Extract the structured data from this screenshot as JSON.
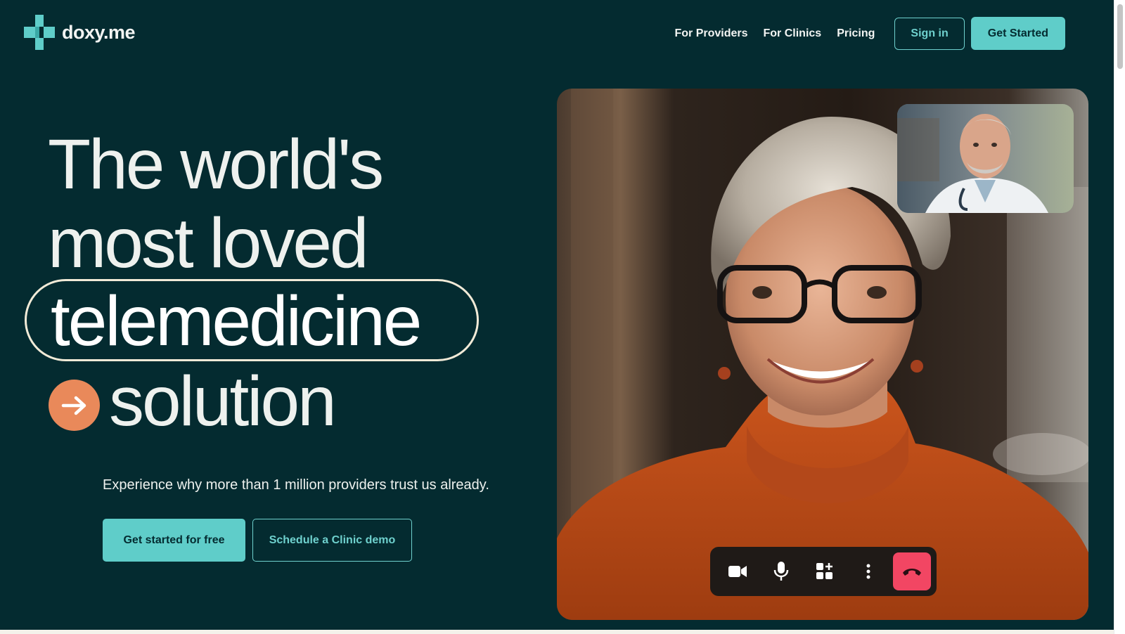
{
  "header": {
    "logo_text": "doxy.me",
    "nav": [
      "For Providers",
      "For Clinics",
      "Pricing"
    ],
    "sign_in_label": "Sign in",
    "get_started_label": "Get Started"
  },
  "hero": {
    "line1": "The world's",
    "line2": "most loved",
    "line3": "telemedicine",
    "line4": "solution",
    "subtext": "Experience why more than 1 million providers trust us already.",
    "cta_primary": "Get started for free",
    "cta_secondary": "Schedule a Clinic demo"
  },
  "video_call": {
    "controls": [
      "video-camera-icon",
      "microphone-icon",
      "apps-add-icon",
      "more-vertical-icon",
      "end-call-icon"
    ]
  },
  "colors": {
    "background": "#042b30",
    "accent_teal": "#5fcdc9",
    "accent_orange": "#e9895a",
    "end_call_red": "#f24663",
    "pill_outline": "#f1ead7"
  }
}
